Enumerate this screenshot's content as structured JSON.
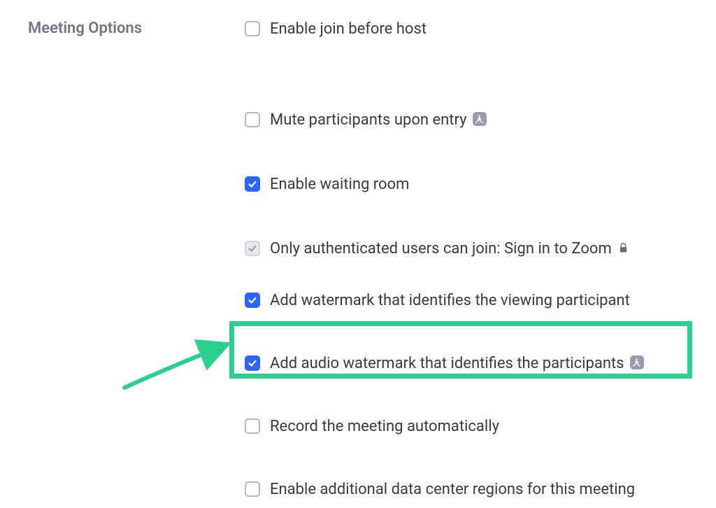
{
  "section": {
    "label": "Meeting Options"
  },
  "options": [
    {
      "label": "Enable join before host",
      "checked": false,
      "disabled": false,
      "info": false,
      "lock": false
    },
    {
      "label": "Mute participants upon entry",
      "checked": false,
      "disabled": false,
      "info": true,
      "lock": false
    },
    {
      "label": "Enable waiting room",
      "checked": true,
      "disabled": false,
      "info": false,
      "lock": false
    },
    {
      "label": "Only authenticated users can join: Sign in to Zoom",
      "checked": true,
      "disabled": true,
      "info": false,
      "lock": true
    },
    {
      "label": "Add watermark that identifies the viewing participant",
      "checked": true,
      "disabled": false,
      "info": false,
      "lock": false
    },
    {
      "label": "Add audio watermark that identifies the participants",
      "checked": true,
      "disabled": false,
      "info": true,
      "lock": false
    },
    {
      "label": "Record the meeting automatically",
      "checked": false,
      "disabled": false,
      "info": false,
      "lock": false
    },
    {
      "label": "Enable additional data center regions for this meeting",
      "checked": false,
      "disabled": false,
      "info": false,
      "lock": false
    }
  ],
  "annotation": {
    "highlight_index": 5,
    "arrow_color": "#2bd08f"
  }
}
